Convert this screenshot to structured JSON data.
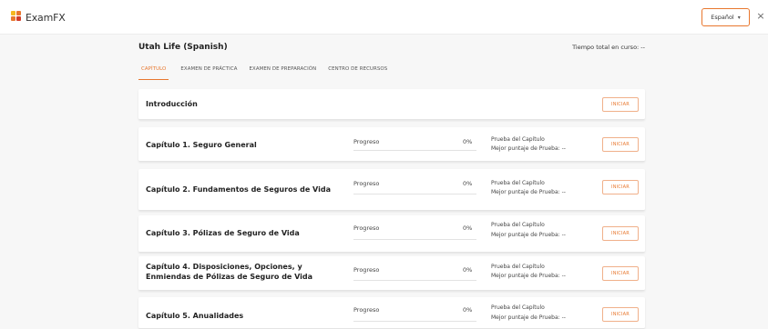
{
  "app": {
    "logo_text": "ExamFX",
    "brand_color": "#e8772e"
  },
  "header": {
    "language_label": "Español",
    "close_label": "×"
  },
  "course": {
    "title": "Utah Life (Spanish)",
    "total_time": "Tiempo total en curso: --"
  },
  "tabs": [
    {
      "label": "CAPÍTULO",
      "active": true
    },
    {
      "label": "EXAMEN DE PRÁCTICA",
      "active": false
    },
    {
      "label": "EXAMEN DE PREPARACIÓN",
      "active": false
    },
    {
      "label": "CENTRO DE RECURSOS",
      "active": false
    }
  ],
  "intro": {
    "title": "Introducción",
    "button": "INICIAR"
  },
  "chapters": [
    {
      "title_line1": "Capítulo 1. Seguro General",
      "title_line2": "",
      "progress_label": "Progreso",
      "progress_pct": "0%",
      "progress_value": 0,
      "test_label": "Prueba del Capítulo",
      "best_score": "Mejor puntaje de Prueba: --",
      "button": "INICIAR"
    },
    {
      "title_line1": "Capítulo 2. Fundamentos de Seguros de Vida",
      "title_line2": "",
      "progress_label": "Progreso",
      "progress_pct": "0%",
      "progress_value": 0,
      "test_label": "Prueba del Capítulo",
      "best_score": "Mejor puntaje de Prueba: --",
      "button": "INICIAR"
    },
    {
      "title_line1": "Capítulo 3. Pólizas de Seguro de Vida",
      "title_line2": "",
      "progress_label": "Progreso",
      "progress_pct": "0%",
      "progress_value": 0,
      "test_label": "Prueba del Capítulo",
      "best_score": "Mejor puntaje de Prueba: --",
      "button": "INICIAR"
    },
    {
      "title_line1": "Capítulo 4. Disposiciones, Opciones, y",
      "title_line2": "Enmiendas de Pólizas de Seguro de Vida",
      "progress_label": "Progreso",
      "progress_pct": "0%",
      "progress_value": 0,
      "test_label": "Prueba del Capítulo",
      "best_score": "Mejor puntaje de Prueba: --",
      "button": "INICIAR"
    },
    {
      "title_line1": "Capítulo 5. Anualidades",
      "title_line2": "",
      "progress_label": "Progreso",
      "progress_pct": "0%",
      "progress_value": 0,
      "test_label": "Prueba del Capítulo",
      "best_score": "Mejor puntaje de Prueba: --",
      "button": "INICIAR"
    }
  ]
}
